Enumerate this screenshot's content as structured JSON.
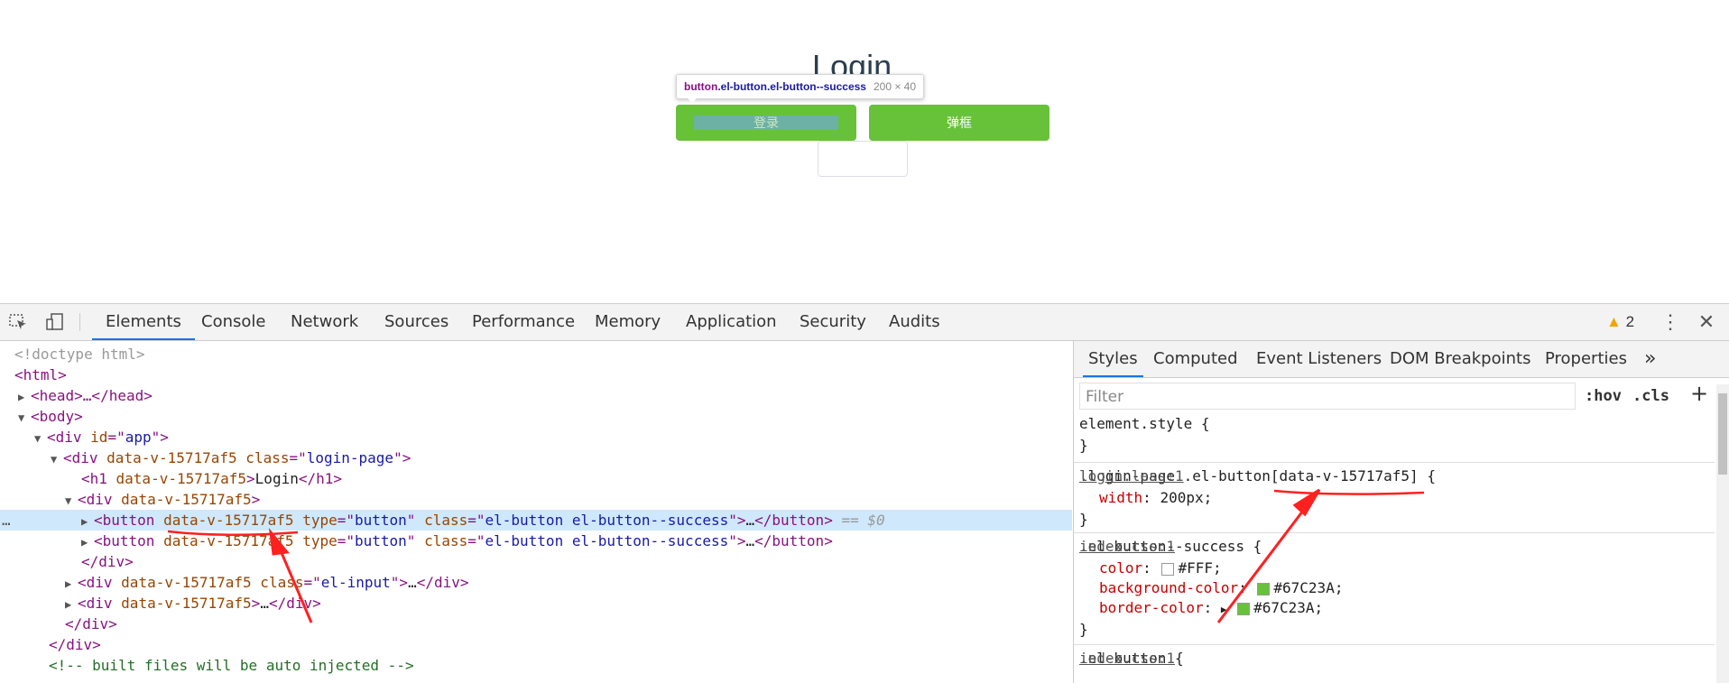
{
  "page": {
    "title": "Login",
    "login_button": "登录",
    "popup_button": "弹框"
  },
  "tooltip": {
    "tag": "button",
    "classes": ".el-button.el-button--success",
    "size": "200 × 40"
  },
  "devtools": {
    "tabs": [
      "Elements",
      "Console",
      "Network",
      "Sources",
      "Performance",
      "Memory",
      "Application",
      "Security",
      "Audits"
    ],
    "warnings": "2",
    "icons": [
      "inspect-icon",
      "device-toolbar-icon",
      "warning-icon",
      "more-icon",
      "close-icon"
    ],
    "dom": {
      "doctype": "<!doctype html>",
      "html_open": "<html>",
      "head": "<head>…</head>",
      "body_open": "<body>",
      "app_div": [
        "<div ",
        "id",
        "=\"",
        "app",
        "\">"
      ],
      "login_page": [
        "<div ",
        "data-v-15717af5",
        " class",
        "=\"",
        "login-page",
        "\">"
      ],
      "h1": [
        "<h1 ",
        "data-v-15717af5",
        ">",
        "Login",
        "</h1>"
      ],
      "div_wrap": [
        "<div ",
        "data-v-15717af5",
        ">"
      ],
      "button1": [
        "<button ",
        "data-v-15717af5",
        " type",
        "=\"",
        "button",
        "\"",
        " class",
        "=\"",
        "el-button el-button--success",
        "\">",
        "…",
        "</button>",
        " == $0"
      ],
      "button2": [
        "<button ",
        "data-v-15717af5",
        " type",
        "=\"",
        "button",
        "\"",
        " class",
        "=\"",
        "el-button el-button--success",
        "\">",
        "…",
        "</button>"
      ],
      "div_close1": "</div>",
      "input_div": [
        "<div ",
        "data-v-15717af5",
        " class",
        "=\"",
        "el-input",
        "\">",
        "…",
        "</div>"
      ],
      "div_more": [
        "<div ",
        "data-v-15717af5",
        ">",
        "…",
        "</div>"
      ],
      "div_close2": "</div>",
      "div_close3": "</div>",
      "comment": "<!-- built files will be auto injected -->"
    },
    "styles": {
      "tabs": [
        "Styles",
        "Computed",
        "Event Listeners",
        "DOM Breakpoints",
        "Properties"
      ],
      "more_tabs": "»",
      "filter_placeholder": "Filter",
      "hov": ":hov",
      "cls": ".cls",
      "add": "+",
      "element_style_open": "element.style {",
      "element_style_close": "}",
      "rule1": {
        "selector_a": ".login-page .el-button",
        "selector_b": "[data-v-15717af5]",
        "brace": " {",
        "source": "login.less:1",
        "prop": "width",
        "value": "200px;",
        "close": "}"
      },
      "rule2": {
        "selector": ".el-button--success {",
        "source": "index.css:1",
        "props": [
          {
            "name": "color",
            "value": "#FFF;",
            "swatch": "#ffffff"
          },
          {
            "name": "background-color",
            "value": "#67C23A;",
            "swatch": "#67c23a"
          },
          {
            "name": "border-color",
            "value": "#67C23A;",
            "swatch": "#67c23a"
          }
        ],
        "close": "}"
      },
      "rule3": {
        "selector": ".el-button {",
        "source": "index.css:1"
      }
    }
  },
  "colors": {
    "success": "#67c23a",
    "accent": "#1a73e8",
    "annotation": "#ff2020"
  }
}
